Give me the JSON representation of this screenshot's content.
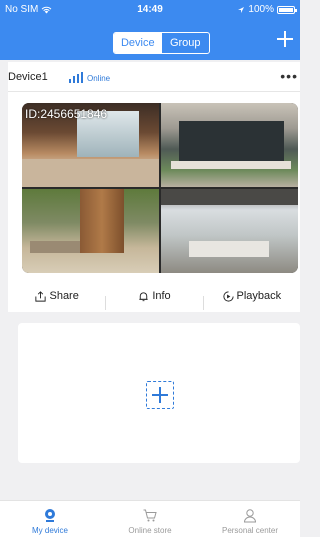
{
  "status_bar": {
    "carrier": "No SIM",
    "time": "14:49",
    "battery": "100%"
  },
  "header": {
    "tabs": [
      {
        "label": "Device",
        "active": true
      },
      {
        "label": "Group",
        "active": false
      }
    ]
  },
  "device": {
    "name": "Device1",
    "status": "Online",
    "camera_id": "ID:2456651846",
    "actions": {
      "share": "Share",
      "info": "Info",
      "playback": "Playback"
    }
  },
  "bottom_nav": {
    "items": [
      {
        "label": "My device",
        "active": true
      },
      {
        "label": "Online store",
        "active": false
      },
      {
        "label": "Personal center",
        "active": false
      }
    ]
  },
  "colors": {
    "accent": "#3c8af0",
    "link": "#2f7ad9",
    "background": "#f0f0f2"
  },
  "icons": [
    "wifi-icon",
    "battery-icon",
    "add-icon",
    "signal-icon",
    "more-icon",
    "share-icon",
    "bell-icon",
    "playback-icon",
    "add-device-icon",
    "camera-icon",
    "cart-icon",
    "person-icon"
  ]
}
